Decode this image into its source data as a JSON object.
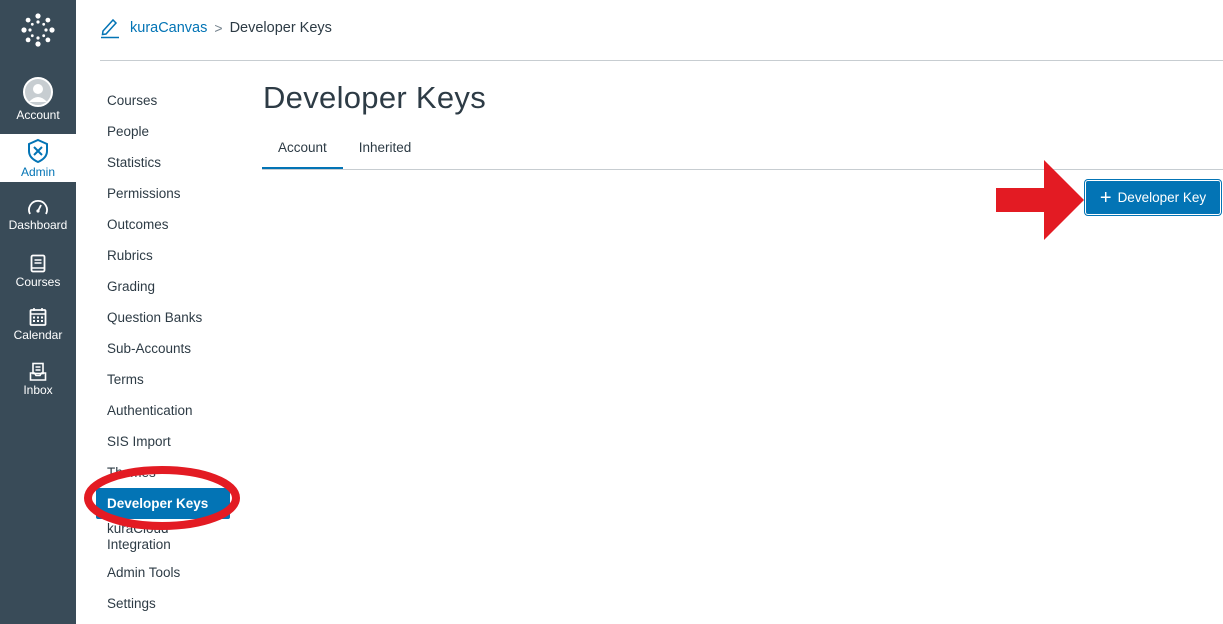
{
  "global_nav": {
    "items": [
      {
        "label": "Account",
        "icon": "user-avatar-icon"
      },
      {
        "label": "Admin",
        "icon": "shield-icon"
      },
      {
        "label": "Dashboard",
        "icon": "speedometer-icon"
      },
      {
        "label": "Courses",
        "icon": "book-icon"
      },
      {
        "label": "Calendar",
        "icon": "calendar-icon"
      },
      {
        "label": "Inbox",
        "icon": "inbox-icon"
      }
    ],
    "active": "Admin"
  },
  "breadcrumb": {
    "root": "kuraCanvas",
    "separator": ">",
    "current": "Developer Keys"
  },
  "section_nav": {
    "items": [
      "Courses",
      "People",
      "Statistics",
      "Permissions",
      "Outcomes",
      "Rubrics",
      "Grading",
      "Question Banks",
      "Sub-Accounts",
      "Terms",
      "Authentication",
      "SIS Import",
      "Themes",
      "Developer Keys",
      "kuraCloud Integration",
      "Admin Tools",
      "Settings"
    ],
    "active": "Developer Keys"
  },
  "main": {
    "title": "Developer Keys",
    "tabs": [
      "Account",
      "Inherited"
    ],
    "active_tab": "Account",
    "add_button_label": "Developer Key"
  },
  "colors": {
    "nav_bg": "#394B58",
    "brand_blue": "#0374B5",
    "annotation_red": "#E31B23"
  }
}
